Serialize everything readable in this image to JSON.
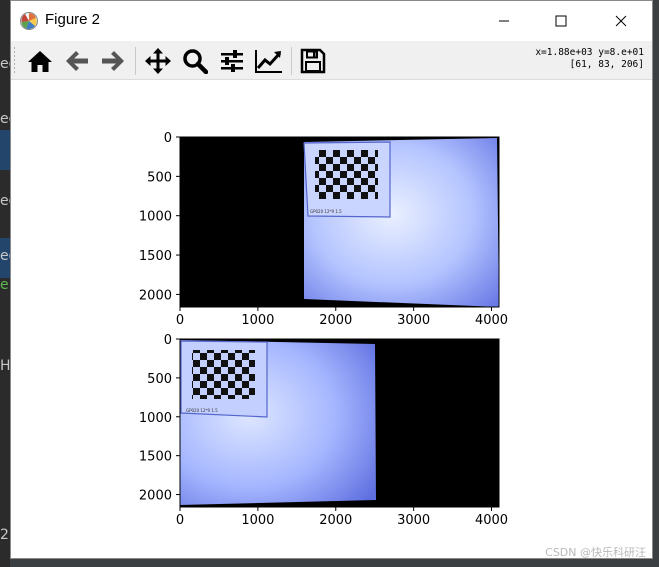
{
  "window": {
    "title": "Figure 2",
    "controls": {
      "minimize": "minimize",
      "maximize": "maximize",
      "close": "close"
    }
  },
  "background_app": {
    "visible_fragments": [
      "ed",
      "ed",
      "ed",
      "ed",
      "e",
      "Нр",
      "2"
    ]
  },
  "toolbar": {
    "buttons": [
      {
        "name": "home",
        "icon": "home-icon"
      },
      {
        "name": "back",
        "icon": "arrow-left-icon"
      },
      {
        "name": "forward",
        "icon": "arrow-right-icon"
      },
      {
        "name": "pan",
        "icon": "move-icon"
      },
      {
        "name": "zoom",
        "icon": "magnifier-icon"
      },
      {
        "name": "configure-subplots",
        "icon": "sliders-icon"
      },
      {
        "name": "edit-axes",
        "icon": "line-chart-icon"
      },
      {
        "name": "save",
        "icon": "floppy-disk-icon"
      }
    ],
    "status_line1": "x=1.88e+03 y=8.e+01",
    "status_line2": "[61, 83, 206]"
  },
  "figure": {
    "subplots": [
      {
        "content": "image",
        "x_ticks": [
          "0",
          "1000",
          "2000",
          "3000",
          "4000"
        ],
        "y_ticks": [
          "0",
          "500",
          "1000",
          "1500",
          "2000"
        ],
        "xlim": [
          0,
          4096
        ],
        "ylim": [
          2160,
          0
        ],
        "card_label": "GP020 12*9 1.5"
      },
      {
        "content": "image",
        "x_ticks": [
          "0",
          "1000",
          "2000",
          "3000",
          "4000"
        ],
        "y_ticks": [
          "0",
          "500",
          "1000",
          "1500",
          "2000"
        ],
        "xlim": [
          0,
          4096
        ],
        "ylim": [
          2160,
          0
        ],
        "card_label": "GP020 12*9 1.5"
      }
    ]
  },
  "colors": {
    "image_light": "#dde7ff",
    "image_mid": "#9ab0ff",
    "image_dark": "#5868d8",
    "background_black": "#000000"
  },
  "watermark": "CSDN @快乐科研汪"
}
